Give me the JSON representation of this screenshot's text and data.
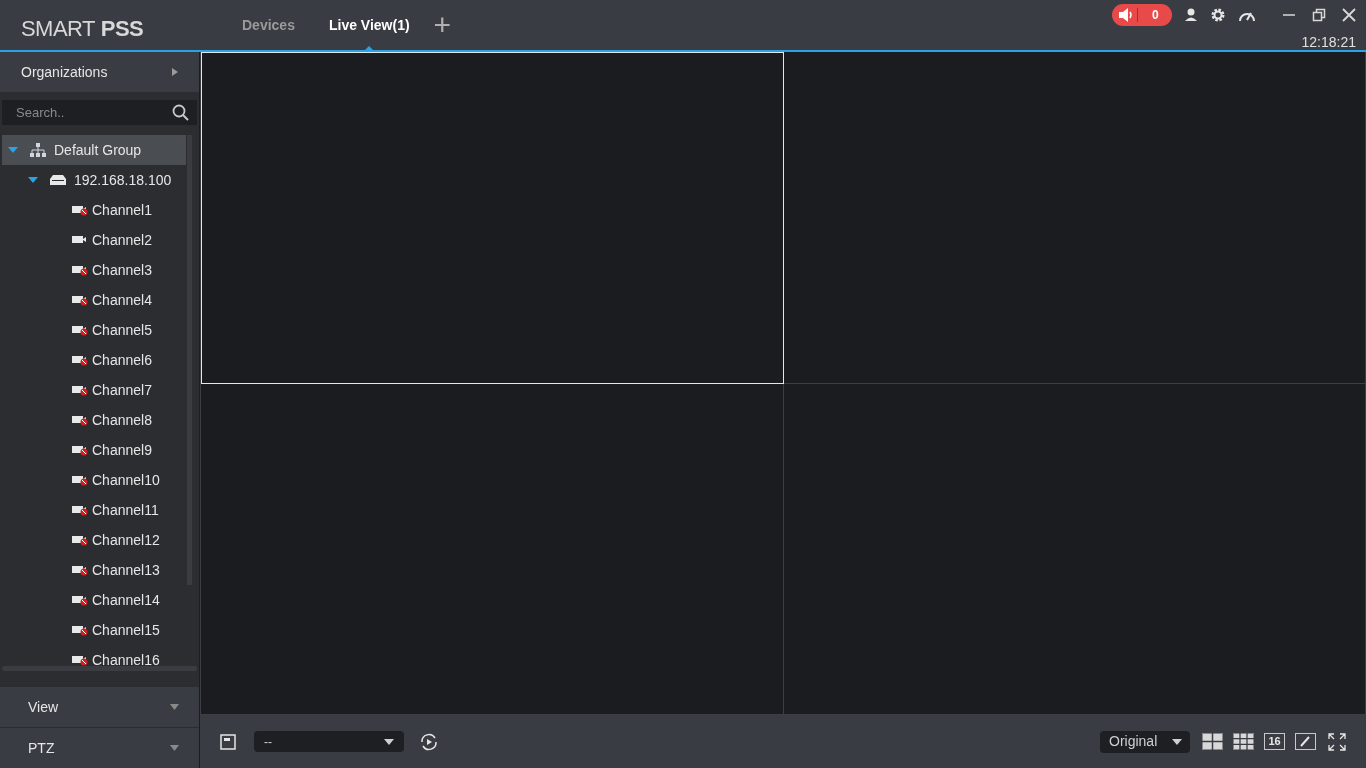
{
  "app": {
    "logo_light": "SMART",
    "logo_bold": "PSS"
  },
  "tabs": [
    {
      "label": "Devices",
      "selected": false
    },
    {
      "label": "Live View(1)",
      "selected": true
    }
  ],
  "add_tab": "+",
  "alarm_count": "0",
  "clock": "12:18:21",
  "sidebar": {
    "organizations": "Organizations",
    "search": {
      "placeholder": "Search.."
    },
    "tree": [
      {
        "label": "Default Group",
        "kind": "group",
        "expanded": true,
        "selected": true,
        "children": [
          {
            "label": "192.168.18.100",
            "kind": "device",
            "expanded": true,
            "selected": false,
            "children": [
              {
                "label": "Channel1",
                "kind": "channel",
                "online": false
              },
              {
                "label": "Channel2",
                "kind": "channel",
                "online": true
              },
              {
                "label": "Channel3",
                "kind": "channel",
                "online": false
              },
              {
                "label": "Channel4",
                "kind": "channel",
                "online": false
              },
              {
                "label": "Channel5",
                "kind": "channel",
                "online": false
              },
              {
                "label": "Channel6",
                "kind": "channel",
                "online": false
              },
              {
                "label": "Channel7",
                "kind": "channel",
                "online": false
              },
              {
                "label": "Channel8",
                "kind": "channel",
                "online": false
              },
              {
                "label": "Channel9",
                "kind": "channel",
                "online": false
              },
              {
                "label": "Channel10",
                "kind": "channel",
                "online": false
              },
              {
                "label": "Channel11",
                "kind": "channel",
                "online": false
              },
              {
                "label": "Channel12",
                "kind": "channel",
                "online": false
              },
              {
                "label": "Channel13",
                "kind": "channel",
                "online": false
              },
              {
                "label": "Channel14",
                "kind": "channel",
                "online": false
              },
              {
                "label": "Channel15",
                "kind": "channel",
                "online": false
              },
              {
                "label": "Channel16",
                "kind": "channel",
                "online": false
              }
            ]
          }
        ]
      }
    ],
    "panels": [
      {
        "label": "View"
      },
      {
        "label": "PTZ"
      }
    ]
  },
  "panes": [
    {
      "selected": true
    },
    {
      "selected": false
    },
    {
      "selected": false
    },
    {
      "selected": false
    }
  ],
  "toolbar": {
    "view_select": "--",
    "ratio_select": "Original",
    "split_16": "16"
  }
}
